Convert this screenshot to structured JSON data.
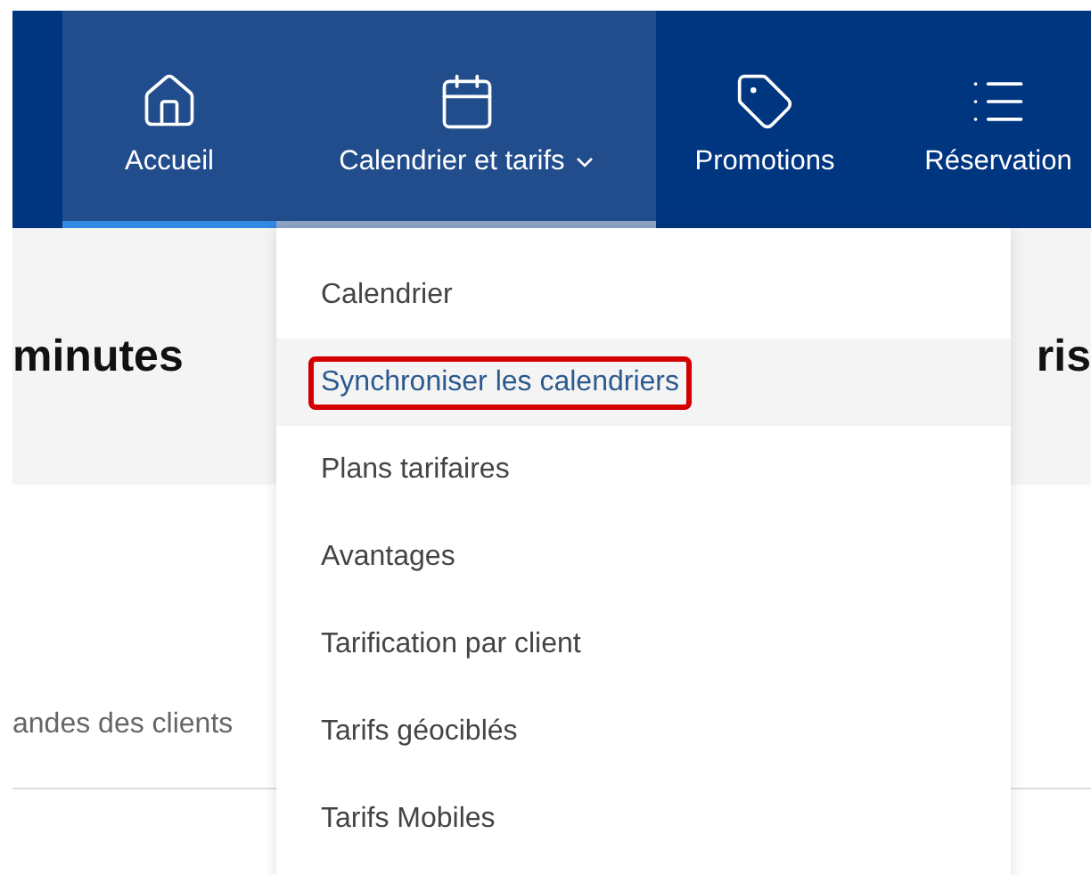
{
  "nav": {
    "tabs": [
      {
        "label": "Accueil",
        "kind": "link",
        "selected": true,
        "expanded": false
      },
      {
        "label": "Calendrier et tarifs",
        "kind": "dropdown",
        "selected": false,
        "expanded": true
      },
      {
        "label": "Promotions",
        "kind": "link",
        "selected": false,
        "expanded": false
      },
      {
        "label": "Réservation",
        "kind": "link",
        "selected": false,
        "expanded": false
      }
    ]
  },
  "content": {
    "heading_left": "minutes",
    "heading_right": "ris",
    "body_text": "andes des clients"
  },
  "dropdown": {
    "items": [
      {
        "label": "Calendrier",
        "selected": false
      },
      {
        "label": "Synchroniser les calendriers",
        "selected": true
      },
      {
        "label": "Plans tarifaires",
        "selected": false
      },
      {
        "label": "Avantages",
        "selected": false
      },
      {
        "label": "Tarification par client",
        "selected": false
      },
      {
        "label": "Tarifs géociblés",
        "selected": false
      },
      {
        "label": "Tarifs Mobiles",
        "selected": false
      }
    ]
  }
}
